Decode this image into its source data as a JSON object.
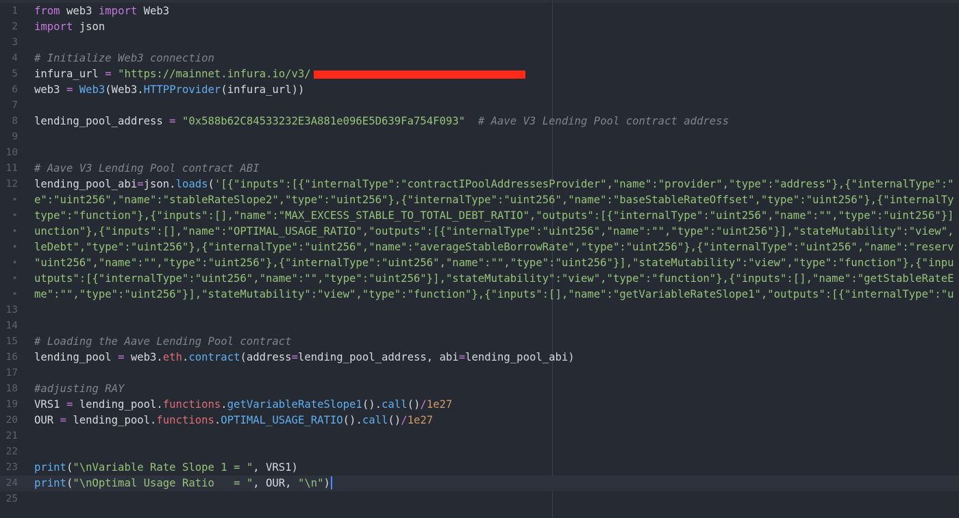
{
  "editor": {
    "lines": [
      {
        "num": "1",
        "tokens": [
          {
            "t": "from",
            "c": "kw"
          },
          {
            "t": " web3 "
          },
          {
            "t": "import",
            "c": "kw"
          },
          {
            "t": " Web3"
          }
        ]
      },
      {
        "num": "2",
        "tokens": [
          {
            "t": "import",
            "c": "kw"
          },
          {
            "t": " json"
          }
        ]
      },
      {
        "num": "3",
        "tokens": []
      },
      {
        "num": "4",
        "tokens": [
          {
            "t": "# Initialize Web3 connection",
            "c": "cm"
          }
        ]
      },
      {
        "num": "5",
        "tokens": [
          {
            "t": "infura_url "
          },
          {
            "t": "=",
            "c": "op"
          },
          {
            "t": " "
          },
          {
            "t": "\"https://mainnet.infura.io/v3/",
            "c": "str"
          }
        ],
        "redacted": true
      },
      {
        "num": "6",
        "tokens": [
          {
            "t": "web3 "
          },
          {
            "t": "=",
            "c": "op"
          },
          {
            "t": " "
          },
          {
            "t": "Web3",
            "c": "fn"
          },
          {
            "t": "(Web3."
          },
          {
            "t": "HTTPProvider",
            "c": "fn"
          },
          {
            "t": "(infura_url))"
          }
        ]
      },
      {
        "num": "7",
        "tokens": []
      },
      {
        "num": "8",
        "tokens": [
          {
            "t": "lending_pool_address "
          },
          {
            "t": "=",
            "c": "op"
          },
          {
            "t": " "
          },
          {
            "t": "\"0x588b62C84533232E3A881e096E5D639Fa754F093\"",
            "c": "str"
          },
          {
            "t": "  "
          },
          {
            "t": "# Aave V3 Lending Pool contract address",
            "c": "cm"
          }
        ]
      },
      {
        "num": "9",
        "tokens": []
      },
      {
        "num": "10",
        "tokens": []
      },
      {
        "num": "11",
        "tokens": [
          {
            "t": "# Aave V3 Lending Pool contract ABI",
            "c": "cm"
          }
        ]
      },
      {
        "num": "12",
        "tokens": [
          {
            "t": "lending_pool_abi"
          },
          {
            "t": "=",
            "c": "op"
          },
          {
            "t": "json."
          },
          {
            "t": "loads",
            "c": "fn"
          },
          {
            "t": "("
          },
          {
            "t": "'[{\"inputs\":[{\"internalType\":\"contractIPoolAddressesProvider\",\"name\":\"provider\",\"type\":\"address\"},{\"internalType\":\"",
            "c": "str"
          }
        ]
      },
      {
        "num": "•",
        "wrap": true,
        "tokens": [
          {
            "t": "e\":\"uint256\",\"name\":\"stableRateSlope2\",\"type\":\"uint256\"},{\"internalType\":\"uint256\",\"name\":\"baseStableRateOffset\",\"type\":\"uint256\"},{\"internalTy",
            "c": "str"
          }
        ]
      },
      {
        "num": "•",
        "wrap": true,
        "tokens": [
          {
            "t": "type\":\"function\"},{\"inputs\":[],\"name\":\"MAX_EXCESS_STABLE_TO_TOTAL_DEBT_RATIO\",\"outputs\":[{\"internalType\":\"uint256\",\"name\":\"\",\"type\":\"uint256\"}]",
            "c": "str"
          }
        ]
      },
      {
        "num": "•",
        "wrap": true,
        "tokens": [
          {
            "t": "unction\"},{\"inputs\":[],\"name\":\"OPTIMAL_USAGE_RATIO\",\"outputs\":[{\"internalType\":\"uint256\",\"name\":\"\",\"type\":\"uint256\"}],\"stateMutability\":\"view\",",
            "c": "str"
          }
        ]
      },
      {
        "num": "•",
        "wrap": true,
        "tokens": [
          {
            "t": "leDebt\",\"type\":\"uint256\"},{\"internalType\":\"uint256\",\"name\":\"averageStableBorrowRate\",\"type\":\"uint256\"},{\"internalType\":\"uint256\",\"name\":\"reserv",
            "c": "str"
          }
        ]
      },
      {
        "num": "•",
        "wrap": true,
        "tokens": [
          {
            "t": "\"uint256\",\"name\":\"\",\"type\":\"uint256\"},{\"internalType\":\"uint256\",\"name\":\"\",\"type\":\"uint256\"}],\"stateMutability\":\"view\",\"type\":\"function\"},{\"inpu",
            "c": "str"
          }
        ]
      },
      {
        "num": "•",
        "wrap": true,
        "tokens": [
          {
            "t": "utputs\":[{\"internalType\":\"uint256\",\"name\":\"\",\"type\":\"uint256\"}],\"stateMutability\":\"view\",\"type\":\"function\"},{\"inputs\":[],\"name\":\"getStableRateE",
            "c": "str"
          }
        ]
      },
      {
        "num": "•",
        "wrap": true,
        "tokens": [
          {
            "t": "me\":\"\",\"type\":\"uint256\"}],\"stateMutability\":\"view\",\"type\":\"function\"},{\"inputs\":[],\"name\":\"getVariableRateSlope1\",\"outputs\":[{\"internalType\":\"u",
            "c": "str"
          }
        ]
      },
      {
        "num": "13",
        "tokens": []
      },
      {
        "num": "14",
        "tokens": []
      },
      {
        "num": "15",
        "tokens": [
          {
            "t": "# Loading the Aave Lending Pool contract",
            "c": "cm"
          }
        ]
      },
      {
        "num": "16",
        "tokens": [
          {
            "t": "lending_pool "
          },
          {
            "t": "=",
            "c": "op"
          },
          {
            "t": " web3."
          },
          {
            "t": "eth",
            "c": "attr"
          },
          {
            "t": "."
          },
          {
            "t": "contract",
            "c": "fn"
          },
          {
            "t": "(address"
          },
          {
            "t": "=",
            "c": "op"
          },
          {
            "t": "lending_pool_address, abi"
          },
          {
            "t": "=",
            "c": "op"
          },
          {
            "t": "lending_pool_abi)"
          }
        ]
      },
      {
        "num": "17",
        "tokens": []
      },
      {
        "num": "18",
        "tokens": [
          {
            "t": "#adjusting RAY",
            "c": "cm"
          }
        ]
      },
      {
        "num": "19",
        "tokens": [
          {
            "t": "VRS1 "
          },
          {
            "t": "=",
            "c": "op"
          },
          {
            "t": " lending_pool."
          },
          {
            "t": "functions",
            "c": "attr"
          },
          {
            "t": "."
          },
          {
            "t": "getVariableRateSlope1",
            "c": "fn"
          },
          {
            "t": "()."
          },
          {
            "t": "call",
            "c": "fn"
          },
          {
            "t": "()"
          },
          {
            "t": "/",
            "c": "op"
          },
          {
            "t": "1e27",
            "c": "num"
          }
        ]
      },
      {
        "num": "20",
        "tokens": [
          {
            "t": "OUR "
          },
          {
            "t": "=",
            "c": "op"
          },
          {
            "t": " lending_pool."
          },
          {
            "t": "functions",
            "c": "attr"
          },
          {
            "t": "."
          },
          {
            "t": "OPTIMAL_USAGE_RATIO",
            "c": "fn"
          },
          {
            "t": "()."
          },
          {
            "t": "call",
            "c": "fn"
          },
          {
            "t": "()"
          },
          {
            "t": "/",
            "c": "op"
          },
          {
            "t": "1e27",
            "c": "num"
          }
        ]
      },
      {
        "num": "21",
        "tokens": []
      },
      {
        "num": "22",
        "tokens": []
      },
      {
        "num": "23",
        "tokens": [
          {
            "t": "print",
            "c": "fn"
          },
          {
            "t": "("
          },
          {
            "t": "\"\\nVariable Rate Slope 1 = \"",
            "c": "str"
          },
          {
            "t": ", VRS1)"
          }
        ]
      },
      {
        "num": "24",
        "active": true,
        "cursor": true,
        "tokens": [
          {
            "t": "print",
            "c": "fn"
          },
          {
            "t": "("
          },
          {
            "t": "\"\\nOptimal Usage Ratio   = \"",
            "c": "str"
          },
          {
            "t": ", OUR, "
          },
          {
            "t": "\"\\n\"",
            "c": "str"
          },
          {
            "t": ")"
          }
        ]
      },
      {
        "num": "25",
        "tokens": []
      }
    ]
  },
  "colors": {
    "background": "#252a33",
    "keyword": "#c678dd",
    "string": "#98c379",
    "comment": "#7f848e",
    "function": "#61afef",
    "attribute": "#e06c75",
    "number": "#d19a66",
    "redaction": "#ff2a1a",
    "cursor": "#528bff"
  }
}
